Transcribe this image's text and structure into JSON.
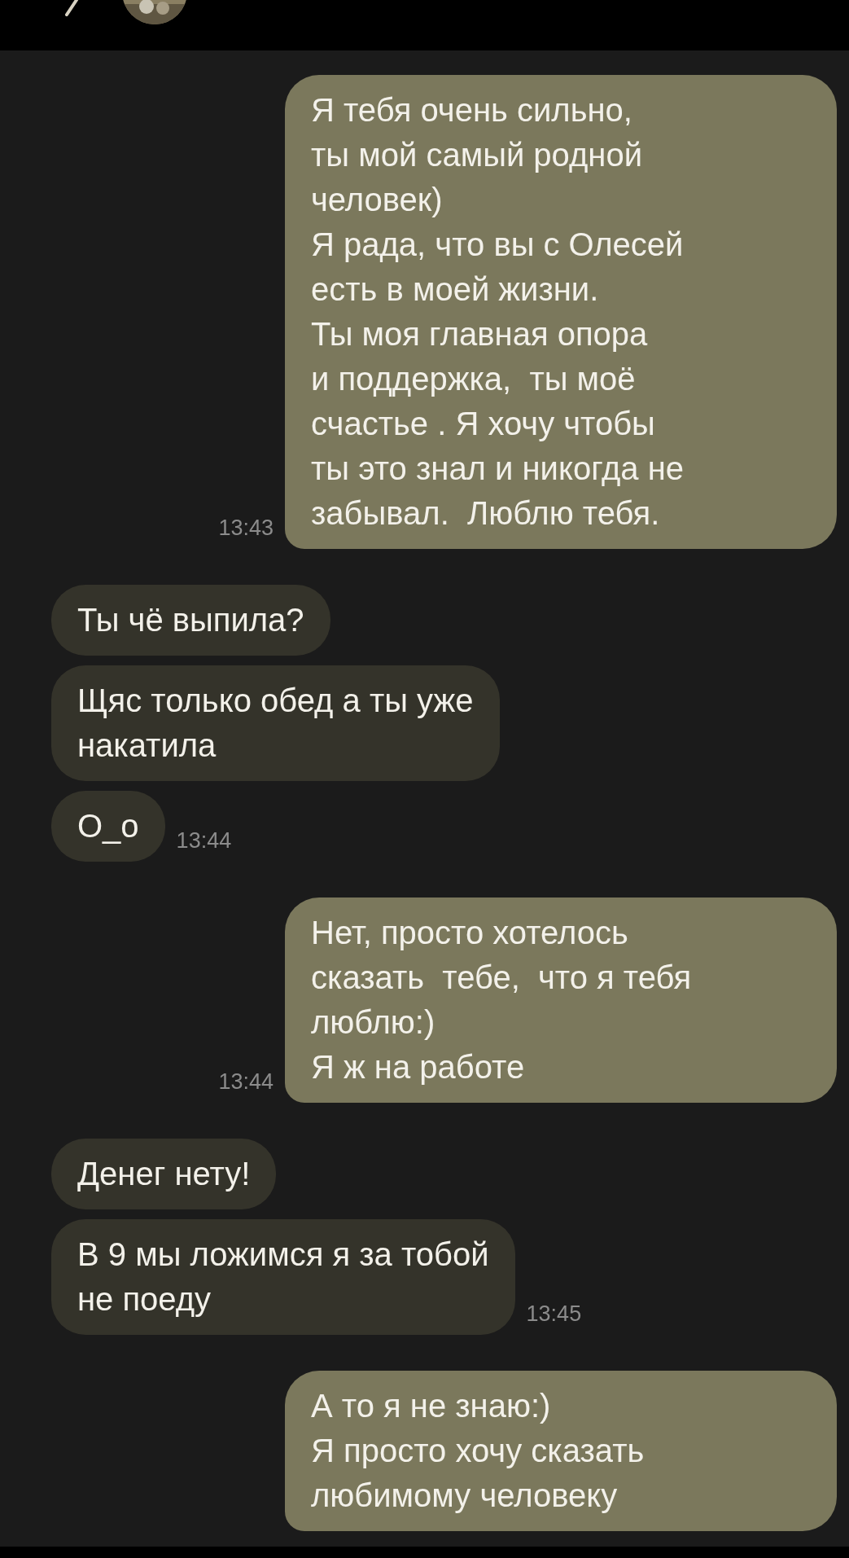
{
  "messages": [
    {
      "kind": "outgoing",
      "text": "Я тебя очень сильно,\nты мой самый родной\nчеловек)\nЯ рада, что вы с Олесей\nесть в моей жизни.\nТы моя главная опора\nи поддержка,  ты моё\nсчастье . Я хочу чтобы\nты это знал и никогда не\nзабывал.  Люблю тебя.",
      "time": "13:43"
    },
    {
      "kind": "incoming",
      "text": "Ты чё выпила?"
    },
    {
      "kind": "incoming",
      "text": "Щяс только обед а ты уже\nнакатила"
    },
    {
      "kind": "incoming",
      "text": "О_о",
      "time": "13:44"
    },
    {
      "kind": "outgoing",
      "text": "Нет, просто хотелось\nсказать  тебе,  что я тебя\nлюблю:)\nЯ ж на работе",
      "time": "13:44"
    },
    {
      "kind": "incoming",
      "text": "Денег нету!"
    },
    {
      "kind": "incoming",
      "text": "В 9 мы ложимся я за тобой\nне поеду",
      "time": "13:45"
    },
    {
      "kind": "outgoing",
      "text": "А то я не знаю:)\nЯ просто хочу сказать\nлюбимому человеку"
    }
  ]
}
